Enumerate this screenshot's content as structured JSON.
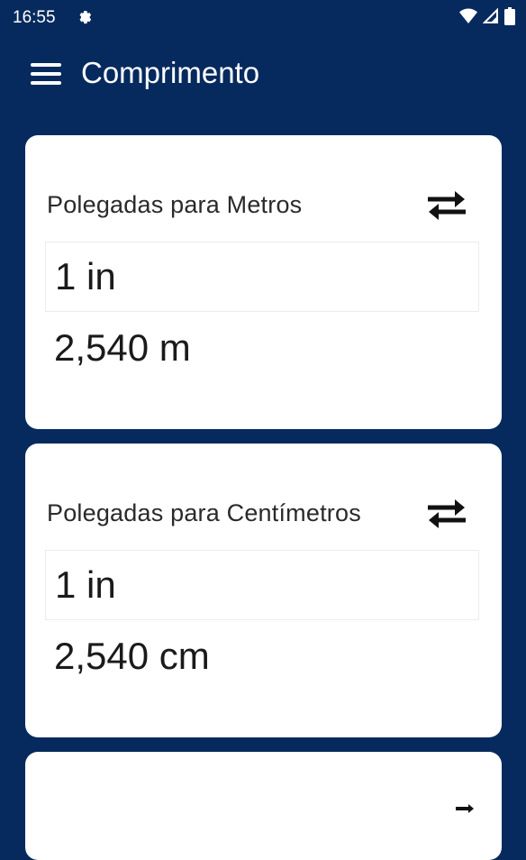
{
  "status": {
    "time": "16:55"
  },
  "app_bar": {
    "title": "Comprimento"
  },
  "cards": [
    {
      "title": "Polegadas para Metros",
      "input_value": "1 in",
      "result": "2,540 m"
    },
    {
      "title": "Polegadas para Centímetros",
      "input_value": "1 in",
      "result": "2,540 cm"
    }
  ],
  "colors": {
    "background": "#062a5e",
    "card": "#ffffff",
    "text": "#1a1a1a"
  },
  "icons": [
    "settings-gear-icon",
    "wifi-icon",
    "signal-icon",
    "battery-icon",
    "menu-icon",
    "swap-arrows-icon"
  ]
}
